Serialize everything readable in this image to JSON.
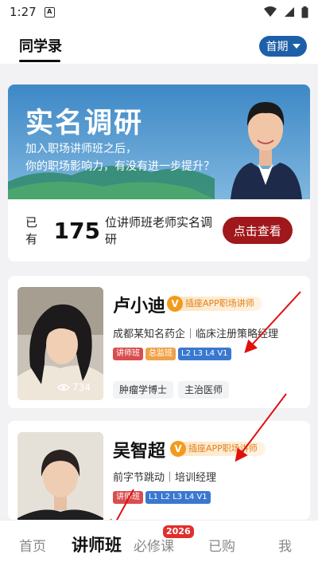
{
  "status_bar": {
    "time": "1:27",
    "notif_letter": "A"
  },
  "header": {
    "title": "同学录",
    "period": "首期"
  },
  "banner": {
    "title": "实名调研",
    "subtitle_line1": "加入职场讲师班之后，",
    "subtitle_line2": "你的职场影响力，有没有进一步提升？",
    "survey_prefix": "已有",
    "survey_count": "175",
    "survey_suffix": "位讲师班老师实名调研",
    "cta_label": "点击查看"
  },
  "teachers": [
    {
      "name": "卢小迪",
      "verify_label": "插座APP职场讲师",
      "org": "成都某知名药企｜临床注册策略经理",
      "badges": [
        "讲师班",
        "总监班",
        "L2 L3 L4 V1"
      ],
      "views": "734",
      "tags": [
        "肿瘤学博士",
        "主治医师"
      ]
    },
    {
      "name": "吴智超",
      "verify_label": "插座APP职场讲师",
      "org": "前字节跳动｜培训经理",
      "badges": [
        "讲师班",
        "L1 L2 L3 L4 V1"
      ]
    }
  ],
  "nav": {
    "items": [
      "首页",
      "讲师班",
      "必修课",
      "已购",
      "我"
    ],
    "active_index": 1,
    "badge": "2026"
  },
  "colors": {
    "accent_blue": "#1d5fa8",
    "cta_red": "#a0181b",
    "badge_orange": "#f39a1e"
  }
}
